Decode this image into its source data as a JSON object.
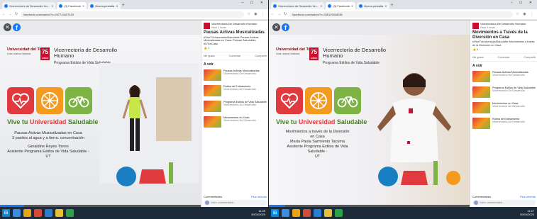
{
  "left": {
    "tabs": [
      {
        "label": "Vicerrectoría de Desarrollo Hu...",
        "active": false
      },
      {
        "label": "(3) Facebook",
        "active": true
      },
      {
        "label": "Nueva pestaña",
        "active": false
      }
    ],
    "address": "facebook.com/watch/?v=267714427420",
    "page_name": "Vicerrectoría De Desarrollo Humano",
    "post_time": "Hace 2 horas",
    "post_title": "Pausas Activas Musicalizadas",
    "post_desc": "#ViveTuUniversidadSaludable Pausas Activas Musicalizadas en Casa. Pausas Saludables #UTenCasa",
    "reactions": "2",
    "actions": [
      "Me gusta",
      "Comentar",
      "Compartir"
    ],
    "a_voir": "A voir",
    "suggestions": [
      {
        "title": "Pausas Activas Musicalizadas",
        "sub": "Vicerrectoría De Desarrollo"
      },
      {
        "title": "Rutina de Estiramiento",
        "sub": "Vicerrectoría De Desarrollo"
      },
      {
        "title": "Programa Estilos de Vida Saludable",
        "sub": "Vicerrectoría De Desarrollo"
      },
      {
        "title": "Movimientos en Casa",
        "sub": "Vicerrectoría De Desarrollo"
      }
    ],
    "comments_label": "Commentaires",
    "comments_link": "Plus récents",
    "comment_placeholder": "Votre commentaire...",
    "video_caption": [
      "Pausas Activas Musicalizadas en Casa",
      "3 pasitos al agua y a tierra. concentración",
      "",
      "Geraldine Reyes Torres",
      "Asistente Programa Estilos de Vida Saludable -",
      "UT"
    ],
    "progress": 0.12
  },
  "right": {
    "tabs": [
      {
        "label": "Vicerrectoría de Desarrollo Hu...",
        "active": false
      },
      {
        "label": "(3) Facebook",
        "active": true
      },
      {
        "label": "Nueva pestaña",
        "active": false
      }
    ],
    "address": "facebook.com/watch/?v=265129048281",
    "page_name": "Vicerrectoría De Desarrollo Humano",
    "post_time": "Hace 3 horas",
    "post_title": "Movimientos a Través de la Diversión en Casa",
    "post_desc": "#ViveTuUniversidadSaludable Movimientos a través de la Diversión en Casa",
    "reactions": "4",
    "actions": [
      "Me gusta",
      "Comentar",
      "Compartir"
    ],
    "a_voir": "A voir",
    "suggestions": [
      {
        "title": "Pausas Activas Musicalizadas",
        "sub": "Vicerrectoría De Desarrollo"
      },
      {
        "title": "Programa Estilos de Vida Saludable",
        "sub": "Vicerrectoría De Desarrollo"
      },
      {
        "title": "Movimientos en Casa",
        "sub": "Vicerrectoría De Desarrollo"
      },
      {
        "title": "Rutina de Estiramiento",
        "sub": "Vicerrectoría De Desarrollo"
      }
    ],
    "comments_label": "Commentaires",
    "comments_link": "Plus récents",
    "comment_placeholder": "Votre commentaire...",
    "video_caption": [
      "Movimientos a través de la Diversión",
      "en Casa",
      "María Paula Sarmiento Tacuma",
      "Asistente Programa Estilos de Vida",
      "Saludable -",
      "UT"
    ],
    "progress": 0.08
  },
  "brand": {
    "university": "Universidad del Tolima",
    "university_tag": "Una nueva historia",
    "anniversary": "75",
    "anniversary_sub": "AÑOS",
    "vice": "Vicerrectoría de Desarrollo Humano",
    "program": "Programa Estilos de Vida Saludable",
    "vive": "Vive tu",
    "vive_highlight": "Universidad",
    "vive_end": "Saludable"
  },
  "taskbar_left": {
    "time": "11:45",
    "date": "30/04/2020"
  },
  "taskbar_right": {
    "time": "11:47",
    "date": "30/04/2020"
  },
  "colors": {
    "fb_blue": "#1877f2",
    "ut_red": "#c8102e",
    "orange": "#f39a1f",
    "green": "#7cb342"
  }
}
